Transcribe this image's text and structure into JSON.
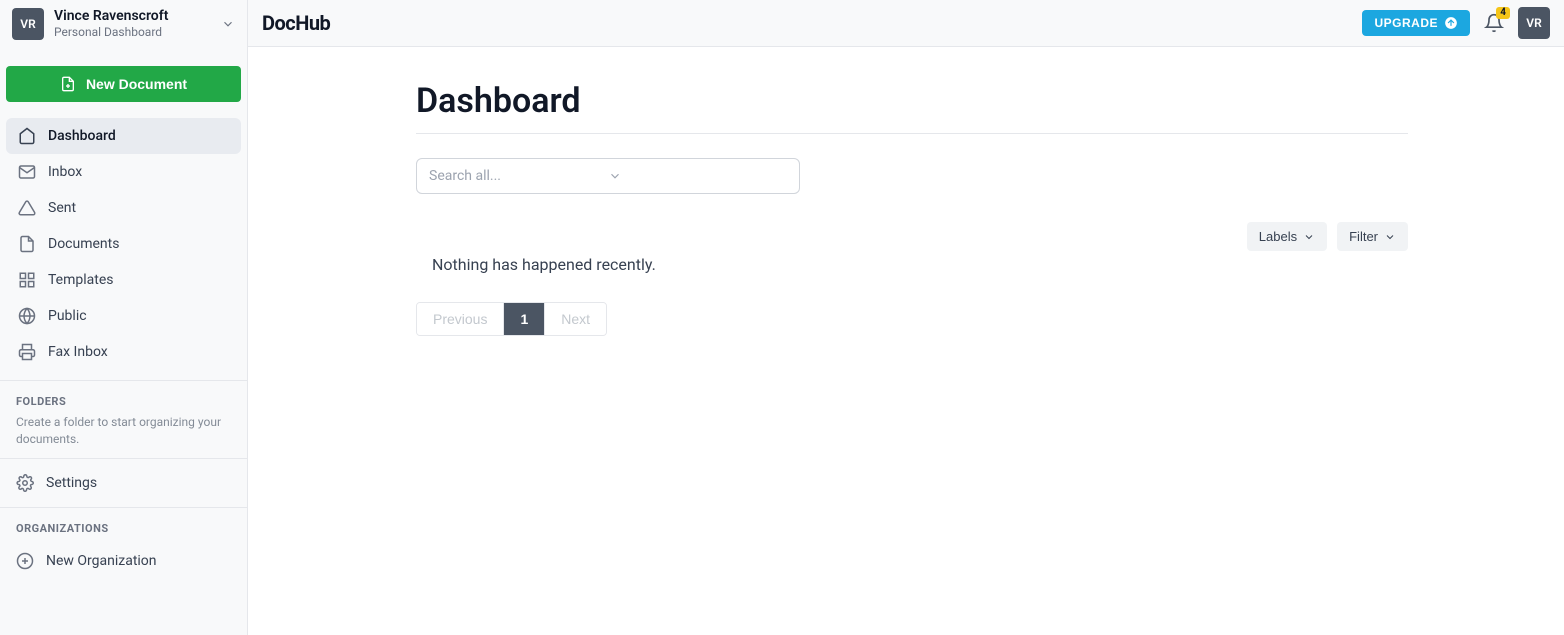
{
  "user": {
    "initials": "VR",
    "name": "Vince Ravenscroft",
    "subtitle": "Personal Dashboard"
  },
  "sidebar": {
    "newDocLabel": "New Document",
    "nav": [
      {
        "label": "Dashboard"
      },
      {
        "label": "Inbox"
      },
      {
        "label": "Sent"
      },
      {
        "label": "Documents"
      },
      {
        "label": "Templates"
      },
      {
        "label": "Public"
      },
      {
        "label": "Fax Inbox"
      }
    ],
    "foldersTitle": "FOLDERS",
    "foldersHelp": "Create a folder to start organizing your documents.",
    "settingsLabel": "Settings",
    "organizationsTitle": "ORGANIZATIONS",
    "newOrgLabel": "New Organization"
  },
  "topbar": {
    "logo": "DocHub",
    "upgradeLabel": "UPGRADE",
    "notificationCount": "4"
  },
  "main": {
    "title": "Dashboard",
    "searchPlaceholder": "Search all...",
    "labelsLabel": "Labels",
    "filterLabel": "Filter",
    "emptyMessage": "Nothing has happened recently.",
    "pagination": {
      "prev": "Previous",
      "current": "1",
      "next": "Next"
    }
  }
}
